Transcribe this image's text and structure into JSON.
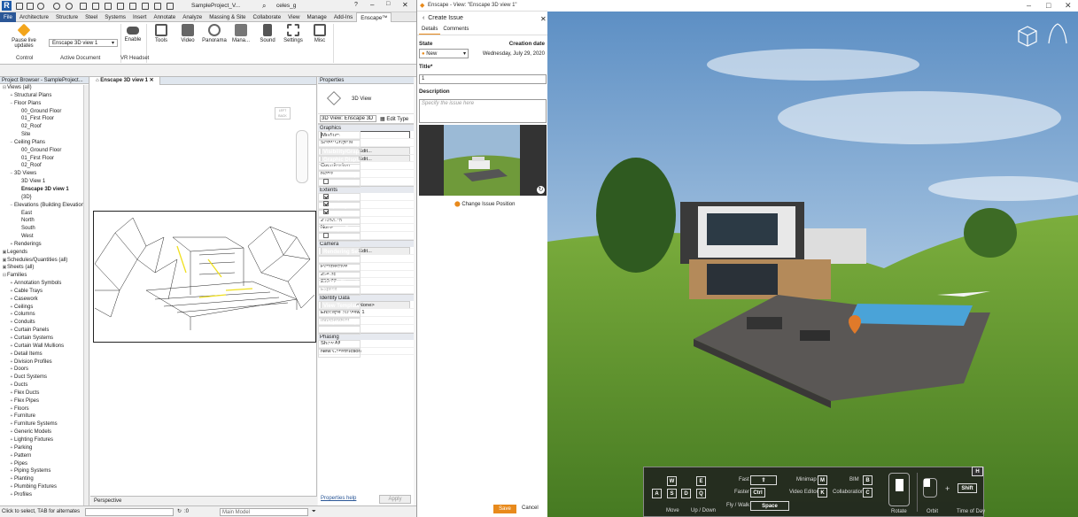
{
  "revit": {
    "qat": {
      "doc_title": "SampleProject_V...",
      "user": "celes_g"
    },
    "tabs": [
      "File",
      "Architecture",
      "Structure",
      "Steel",
      "Systems",
      "Insert",
      "Annotate",
      "Analyze",
      "Massing & Site",
      "Collaborate",
      "View",
      "Manage",
      "Add-Ins",
      "Enscape™"
    ],
    "ribbon": {
      "pause": "Pause live updates",
      "view_select": "Enscape 3D view 1",
      "enable": "Enable",
      "tools": "Tools",
      "video": "Video",
      "panorama": "Panorama",
      "manage": "Mana...",
      "sound": "Sound",
      "settings": "Settings",
      "misc": "Misc",
      "panels": {
        "control": "Control",
        "active_doc": "Active Document",
        "vr": "VR Headset"
      }
    },
    "browser": {
      "title": "Project Browser - SampleProject...",
      "items": [
        {
          "t": "Views (all)",
          "d": 0,
          "e": "⊟"
        },
        {
          "t": "Structural Plans",
          "d": 1,
          "e": "+"
        },
        {
          "t": "Floor Plans",
          "d": 1,
          "e": "−"
        },
        {
          "t": "00_Ground Floor",
          "d": 2,
          "e": ""
        },
        {
          "t": "01_First Floor",
          "d": 2,
          "e": ""
        },
        {
          "t": "02_Roof",
          "d": 2,
          "e": ""
        },
        {
          "t": "Site",
          "d": 2,
          "e": ""
        },
        {
          "t": "Ceiling Plans",
          "d": 1,
          "e": "−"
        },
        {
          "t": "00_Ground Floor",
          "d": 2,
          "e": ""
        },
        {
          "t": "01_First Floor",
          "d": 2,
          "e": ""
        },
        {
          "t": "02_Roof",
          "d": 2,
          "e": ""
        },
        {
          "t": "3D Views",
          "d": 1,
          "e": "−"
        },
        {
          "t": "3D View 1",
          "d": 2,
          "e": ""
        },
        {
          "t": "Enscape 3D view 1",
          "d": 2,
          "e": "",
          "b": true
        },
        {
          "t": "{3D}",
          "d": 2,
          "e": ""
        },
        {
          "t": "Elevations (Building Elevation)",
          "d": 1,
          "e": "−"
        },
        {
          "t": "East",
          "d": 2,
          "e": ""
        },
        {
          "t": "North",
          "d": 2,
          "e": ""
        },
        {
          "t": "South",
          "d": 2,
          "e": ""
        },
        {
          "t": "West",
          "d": 2,
          "e": ""
        },
        {
          "t": "Renderings",
          "d": 1,
          "e": "+"
        },
        {
          "t": "Legends",
          "d": 0,
          "e": "▣"
        },
        {
          "t": "Schedules/Quantities (all)",
          "d": 0,
          "e": "▣"
        },
        {
          "t": "Sheets (all)",
          "d": 0,
          "e": "▣"
        },
        {
          "t": "Families",
          "d": 0,
          "e": "⊟"
        },
        {
          "t": "Annotation Symbols",
          "d": 1,
          "e": "+"
        },
        {
          "t": "Cable Trays",
          "d": 1,
          "e": "+"
        },
        {
          "t": "Casework",
          "d": 1,
          "e": "+"
        },
        {
          "t": "Ceilings",
          "d": 1,
          "e": "+"
        },
        {
          "t": "Columns",
          "d": 1,
          "e": "+"
        },
        {
          "t": "Conduits",
          "d": 1,
          "e": "+"
        },
        {
          "t": "Curtain Panels",
          "d": 1,
          "e": "+"
        },
        {
          "t": "Curtain Systems",
          "d": 1,
          "e": "+"
        },
        {
          "t": "Curtain Wall Mullions",
          "d": 1,
          "e": "+"
        },
        {
          "t": "Detail Items",
          "d": 1,
          "e": "+"
        },
        {
          "t": "Division Profiles",
          "d": 1,
          "e": "+"
        },
        {
          "t": "Doors",
          "d": 1,
          "e": "+"
        },
        {
          "t": "Duct Systems",
          "d": 1,
          "e": "+"
        },
        {
          "t": "Ducts",
          "d": 1,
          "e": "+"
        },
        {
          "t": "Flex Ducts",
          "d": 1,
          "e": "+"
        },
        {
          "t": "Flex Pipes",
          "d": 1,
          "e": "+"
        },
        {
          "t": "Floors",
          "d": 1,
          "e": "+"
        },
        {
          "t": "Furniture",
          "d": 1,
          "e": "+"
        },
        {
          "t": "Furniture Systems",
          "d": 1,
          "e": "+"
        },
        {
          "t": "Generic Models",
          "d": 1,
          "e": "+"
        },
        {
          "t": "Lighting Fixtures",
          "d": 1,
          "e": "+"
        },
        {
          "t": "Parking",
          "d": 1,
          "e": "+"
        },
        {
          "t": "Pattern",
          "d": 1,
          "e": "+"
        },
        {
          "t": "Pipes",
          "d": 1,
          "e": "+"
        },
        {
          "t": "Piping Systems",
          "d": 1,
          "e": "+"
        },
        {
          "t": "Planting",
          "d": 1,
          "e": "+"
        },
        {
          "t": "Plumbing Fixtures",
          "d": 1,
          "e": "+"
        },
        {
          "t": "Profiles",
          "d": 1,
          "e": "+"
        }
      ]
    },
    "view": {
      "tab": "Enscape 3D view 1",
      "perspective": "Perspective",
      "cube": "LEFT BACK"
    },
    "props": {
      "title": "Properties",
      "type": "3D View",
      "selector": "3D View: Enscape 3D",
      "edit_type": "Edit Type",
      "groups": [
        {
          "name": "Graphics",
          "rows": [
            {
              "k": "Detail Level",
              "v": "Medium",
              "f": "box"
            },
            {
              "k": "Parts Visibility",
              "v": "Show Original"
            },
            {
              "k": "Visibility/Graphi...",
              "v": "Edit...",
              "f": "btn"
            },
            {
              "k": "Graphic Display...",
              "v": "Edit...",
              "f": "btn"
            },
            {
              "k": "Discipline",
              "v": "Coordination"
            },
            {
              "k": "Default Analysis...",
              "v": "None"
            },
            {
              "k": "Sun Path",
              "v": "",
              "f": "off"
            }
          ]
        },
        {
          "name": "Extents",
          "rows": [
            {
              "k": "Crop View",
              "v": "",
              "f": "on"
            },
            {
              "k": "Crop Region Vis...",
              "v": "",
              "f": "on"
            },
            {
              "k": "Far Clip Active",
              "v": "",
              "f": "on"
            },
            {
              "k": "Far Clip Offset",
              "v": "20153.75"
            },
            {
              "k": "Scope Box",
              "v": "None"
            },
            {
              "k": "Section Box",
              "v": "",
              "f": "off"
            }
          ]
        },
        {
          "name": "Camera",
          "rows": [
            {
              "k": "Rendering Setti...",
              "v": "Edit...",
              "f": "btn"
            },
            {
              "k": "Locked Orientat...",
              "v": "",
              "f": "dim"
            },
            {
              "k": "Projection Mode",
              "v": "Perspective"
            },
            {
              "k": "Eye Elevation",
              "v": "254.35"
            },
            {
              "k": "Target Elevation",
              "v": "253.77"
            },
            {
              "k": "Camera Position",
              "v": "Explicit",
              "f": "dim"
            }
          ]
        },
        {
          "name": "Identity Data",
          "rows": [
            {
              "k": "View Template",
              "v": "<None>",
              "f": "btn"
            },
            {
              "k": "View Name",
              "v": "Enscape 3D view 1"
            },
            {
              "k": "Dependency",
              "v": "Independent",
              "f": "dim"
            },
            {
              "k": "Title on Sheet",
              "v": ""
            }
          ]
        },
        {
          "name": "Phasing",
          "rows": [
            {
              "k": "Phase Filter",
              "v": "Show All"
            },
            {
              "k": "Phase",
              "v": "New Construction"
            }
          ]
        }
      ],
      "help": "Properties help",
      "apply": "Apply"
    },
    "status": {
      "hint": "Click to select, TAB for alternates",
      "zero": ":0",
      "model": "Main Model"
    }
  },
  "enscape": {
    "window_title": "Enscape - View: \"Enscape 3D view 1\"",
    "header": "Create Issue",
    "tabs": [
      "Details",
      "Comments"
    ],
    "state_label": "State",
    "state_value": "New",
    "creation_label": "Creation date",
    "creation_value": "Wednesday, July 29, 2020",
    "title_label": "Title*",
    "title_value": "1",
    "desc_label": "Description",
    "desc_placeholder": "Specify the issue here",
    "change_pos": "Change Issue Position",
    "save": "Save",
    "cancel": "Cancel",
    "nav": {
      "keys": {
        "w": "W",
        "e": "E",
        "a": "A",
        "s": "S",
        "d": "D",
        "q": "Q",
        "fast_key": "⇧",
        "faster_key": "Ctrl",
        "space": "Space",
        "m": "M",
        "k": "K",
        "b": "B",
        "c": "C",
        "shift": "Shift",
        "h": "H",
        "plus": "+"
      },
      "labels": {
        "move": "Move",
        "updown": "Up / Down",
        "fast": "Fast",
        "faster": "Faster",
        "flywalk": "Fly / Walk",
        "minimap": "Minimap",
        "video_editor": "Video Editor",
        "bim": "BIM",
        "collab": "Collaboration",
        "rotate": "Rotate",
        "orbit": "Orbit",
        "tod": "Time of Day"
      }
    },
    "colors": {
      "accent": "#e88a1c"
    }
  }
}
